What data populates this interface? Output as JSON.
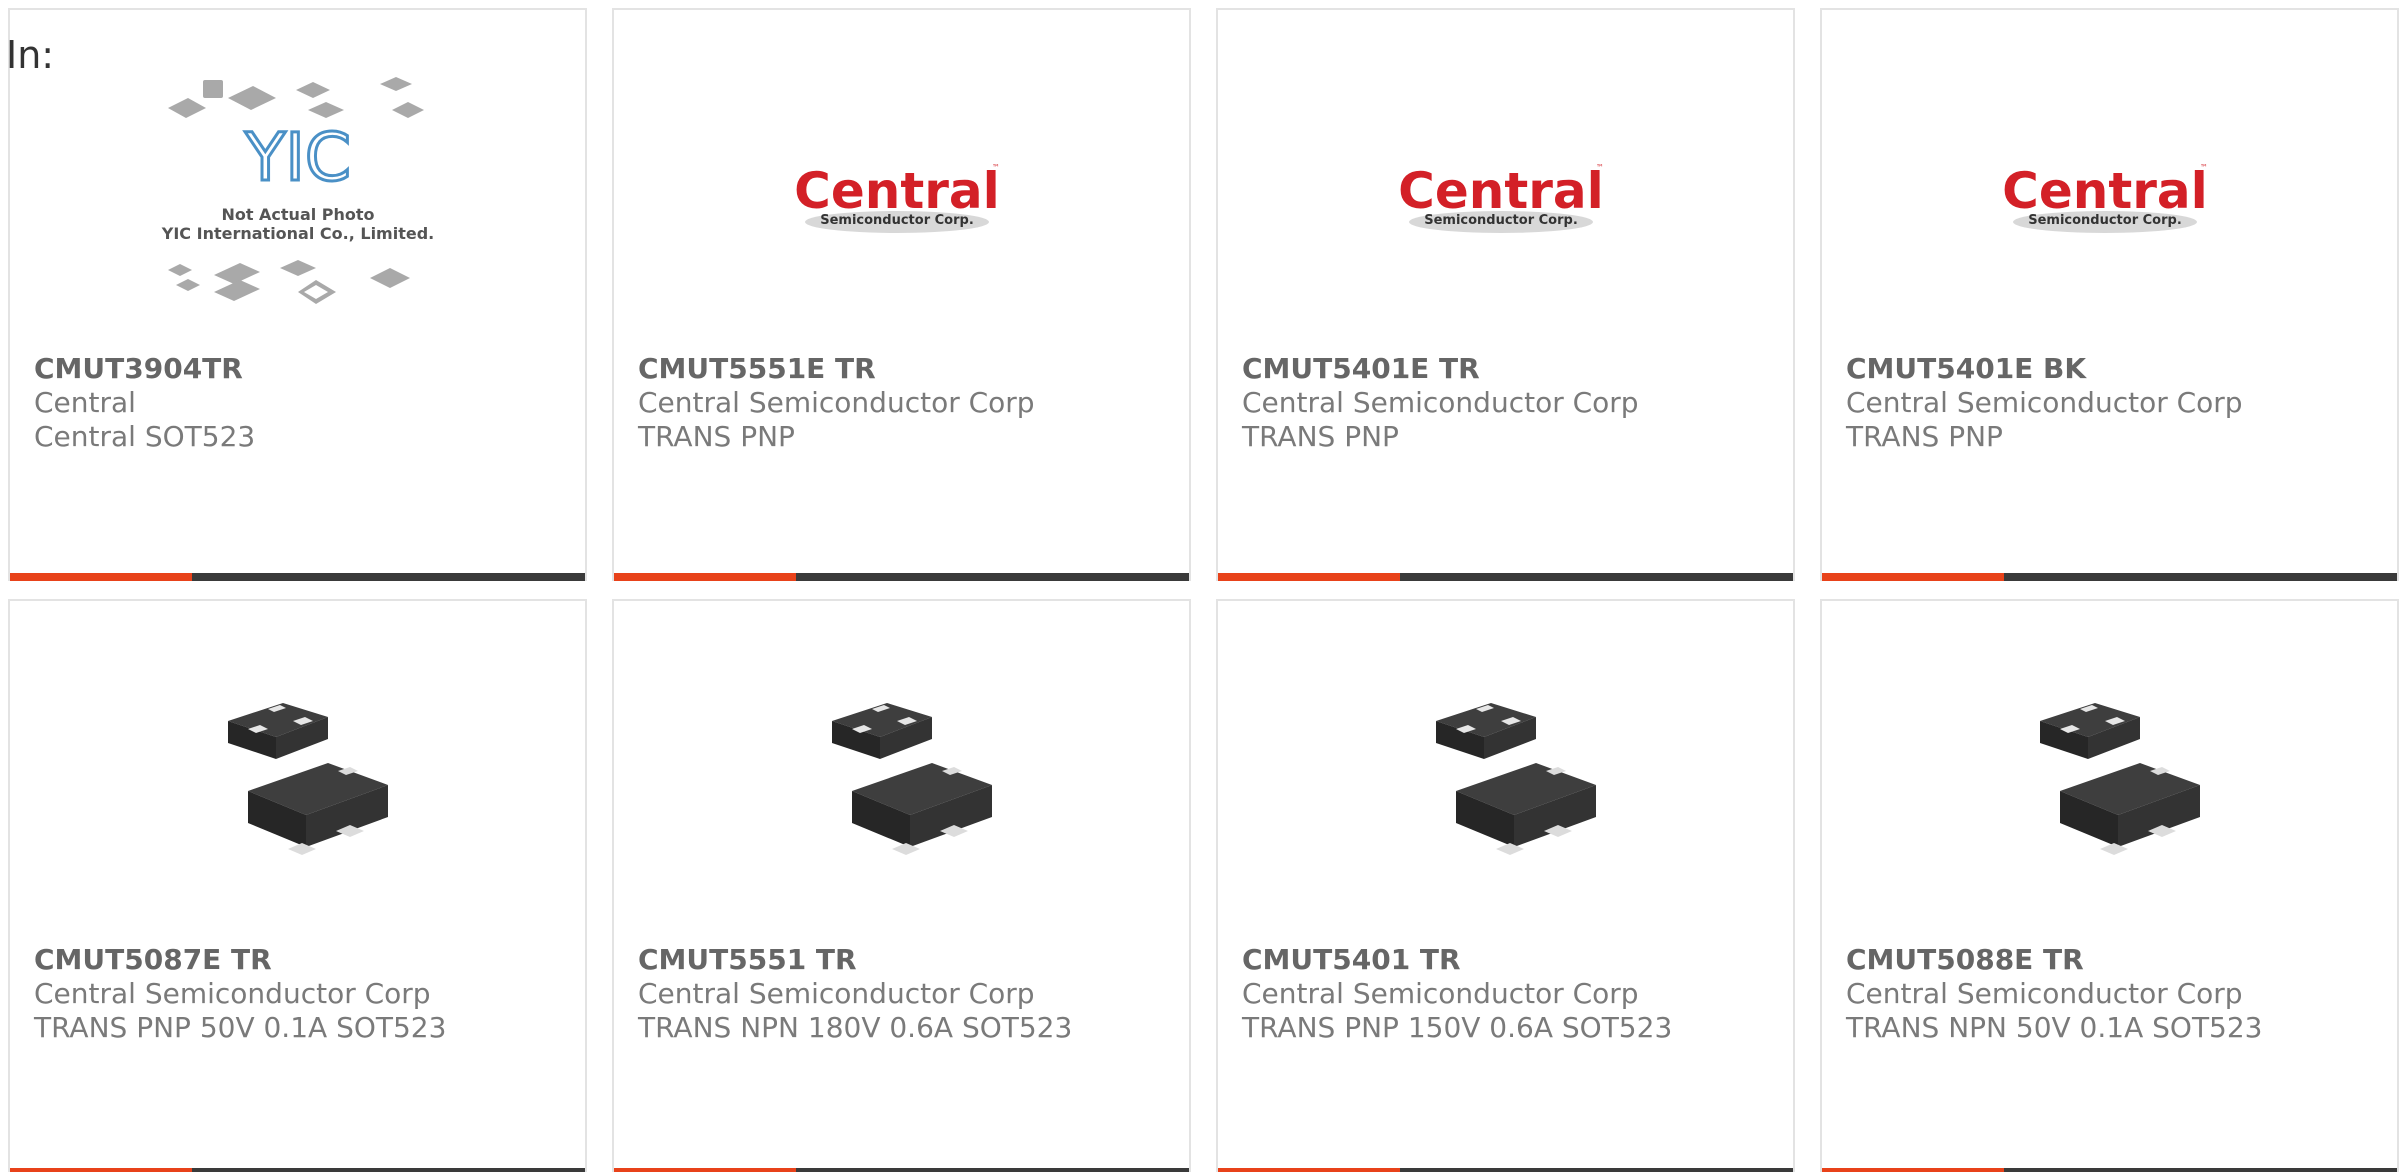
{
  "filter": {
    "label": "In:"
  },
  "colors": {
    "accent": "#e8421a",
    "bar": "#3a3a3a",
    "brand_red": "#d32027"
  },
  "products": [
    {
      "part_number": "CMUT3904TR",
      "manufacturer": "Central",
      "description": "Central SOT523",
      "image": {
        "type": "placeholder",
        "logo": "YIC",
        "line1": "Not Actual Photo",
        "line2": "YIC International Co., Limited."
      }
    },
    {
      "part_number": "CMUT5551E TR",
      "manufacturer": "Central Semiconductor Corp",
      "description": "TRANS PNP",
      "image": {
        "type": "central-logo",
        "brand": "Central",
        "tagline": "Semiconductor Corp."
      }
    },
    {
      "part_number": "CMUT5401E TR",
      "manufacturer": "Central Semiconductor Corp",
      "description": "TRANS PNP",
      "image": {
        "type": "central-logo",
        "brand": "Central",
        "tagline": "Semiconductor Corp."
      }
    },
    {
      "part_number": "CMUT5401E BK",
      "manufacturer": "Central Semiconductor Corp",
      "description": "TRANS PNP",
      "image": {
        "type": "central-logo",
        "brand": "Central",
        "tagline": "Semiconductor Corp."
      }
    },
    {
      "part_number": "CMUT5087E TR",
      "manufacturer": "Central Semiconductor Corp",
      "description": "TRANS PNP 50V 0.1A SOT523",
      "image": {
        "type": "sot523-photo"
      }
    },
    {
      "part_number": "CMUT5551 TR",
      "manufacturer": "Central Semiconductor Corp",
      "description": "TRANS NPN 180V 0.6A SOT523",
      "image": {
        "type": "sot523-photo"
      }
    },
    {
      "part_number": "CMUT5401 TR",
      "manufacturer": "Central Semiconductor Corp",
      "description": "TRANS PNP 150V 0.6A SOT523",
      "image": {
        "type": "sot523-photo"
      }
    },
    {
      "part_number": "CMUT5088E TR",
      "manufacturer": "Central Semiconductor Corp",
      "description": "TRANS NPN 50V 0.1A SOT523",
      "image": {
        "type": "sot523-photo"
      }
    }
  ]
}
